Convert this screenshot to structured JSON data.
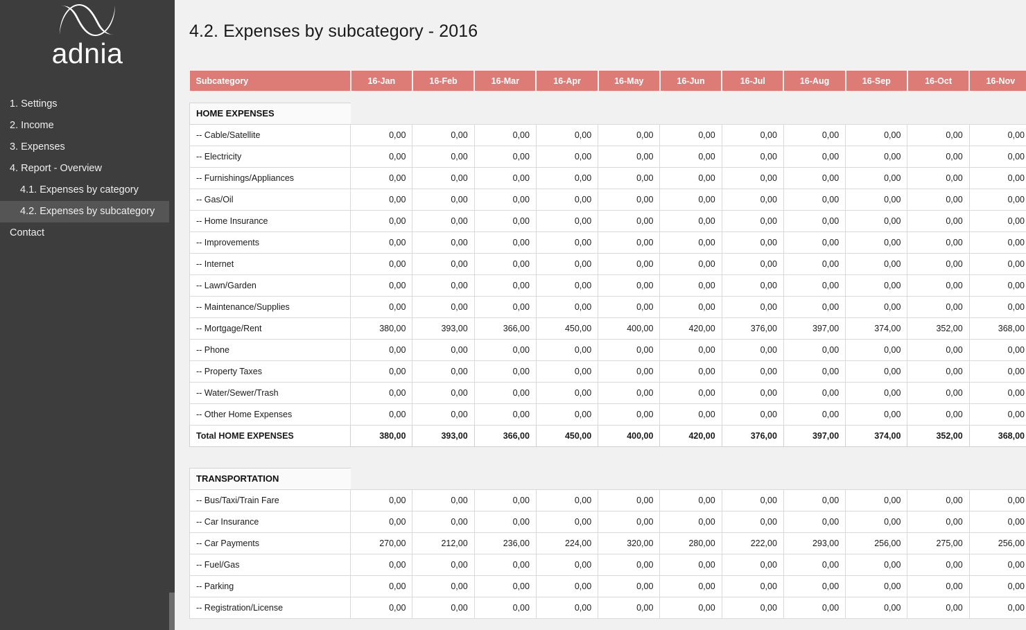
{
  "sidebar": {
    "logo": {
      "mark": "adnia-logo-mark",
      "word": "adnia"
    },
    "items": [
      {
        "label": "1. Settings",
        "level": 1,
        "active": false
      },
      {
        "label": "2. Income",
        "level": 1,
        "active": false
      },
      {
        "label": "3. Expenses",
        "level": 1,
        "active": false
      },
      {
        "label": "4. Report - Overview",
        "level": 1,
        "active": false
      },
      {
        "label": "4.1. Expenses by category",
        "level": 2,
        "active": false
      },
      {
        "label": "4.2. Expenses by subcategory",
        "level": 2,
        "active": true
      },
      {
        "label": "Contact",
        "level": 1,
        "active": false
      }
    ]
  },
  "main": {
    "title": "4.2. Expenses by subcategory - 2016",
    "accent_color": "#dd7c77",
    "table": {
      "columns": [
        "Subcategory",
        "16-Jan",
        "16-Feb",
        "16-Mar",
        "16-Apr",
        "16-May",
        "16-Jun",
        "16-Jul",
        "16-Aug",
        "16-Sep",
        "16-Oct",
        "16-Nov"
      ],
      "sections": [
        {
          "name": "HOME EXPENSES",
          "rows": [
            {
              "label": "-- Cable/Satellite",
              "values": [
                "0,00",
                "0,00",
                "0,00",
                "0,00",
                "0,00",
                "0,00",
                "0,00",
                "0,00",
                "0,00",
                "0,00",
                "0,00"
              ]
            },
            {
              "label": "-- Electricity",
              "values": [
                "0,00",
                "0,00",
                "0,00",
                "0,00",
                "0,00",
                "0,00",
                "0,00",
                "0,00",
                "0,00",
                "0,00",
                "0,00"
              ]
            },
            {
              "label": "-- Furnishings/Appliances",
              "values": [
                "0,00",
                "0,00",
                "0,00",
                "0,00",
                "0,00",
                "0,00",
                "0,00",
                "0,00",
                "0,00",
                "0,00",
                "0,00"
              ]
            },
            {
              "label": "-- Gas/Oil",
              "values": [
                "0,00",
                "0,00",
                "0,00",
                "0,00",
                "0,00",
                "0,00",
                "0,00",
                "0,00",
                "0,00",
                "0,00",
                "0,00"
              ]
            },
            {
              "label": "-- Home Insurance",
              "values": [
                "0,00",
                "0,00",
                "0,00",
                "0,00",
                "0,00",
                "0,00",
                "0,00",
                "0,00",
                "0,00",
                "0,00",
                "0,00"
              ]
            },
            {
              "label": "-- Improvements",
              "values": [
                "0,00",
                "0,00",
                "0,00",
                "0,00",
                "0,00",
                "0,00",
                "0,00",
                "0,00",
                "0,00",
                "0,00",
                "0,00"
              ]
            },
            {
              "label": "-- Internet",
              "values": [
                "0,00",
                "0,00",
                "0,00",
                "0,00",
                "0,00",
                "0,00",
                "0,00",
                "0,00",
                "0,00",
                "0,00",
                "0,00"
              ]
            },
            {
              "label": "-- Lawn/Garden",
              "values": [
                "0,00",
                "0,00",
                "0,00",
                "0,00",
                "0,00",
                "0,00",
                "0,00",
                "0,00",
                "0,00",
                "0,00",
                "0,00"
              ]
            },
            {
              "label": "-- Maintenance/Supplies",
              "values": [
                "0,00",
                "0,00",
                "0,00",
                "0,00",
                "0,00",
                "0,00",
                "0,00",
                "0,00",
                "0,00",
                "0,00",
                "0,00"
              ]
            },
            {
              "label": "-- Mortgage/Rent",
              "values": [
                "380,00",
                "393,00",
                "366,00",
                "450,00",
                "400,00",
                "420,00",
                "376,00",
                "397,00",
                "374,00",
                "352,00",
                "368,00"
              ]
            },
            {
              "label": "-- Phone",
              "values": [
                "0,00",
                "0,00",
                "0,00",
                "0,00",
                "0,00",
                "0,00",
                "0,00",
                "0,00",
                "0,00",
                "0,00",
                "0,00"
              ]
            },
            {
              "label": "-- Property Taxes",
              "values": [
                "0,00",
                "0,00",
                "0,00",
                "0,00",
                "0,00",
                "0,00",
                "0,00",
                "0,00",
                "0,00",
                "0,00",
                "0,00"
              ]
            },
            {
              "label": "-- Water/Sewer/Trash",
              "values": [
                "0,00",
                "0,00",
                "0,00",
                "0,00",
                "0,00",
                "0,00",
                "0,00",
                "0,00",
                "0,00",
                "0,00",
                "0,00"
              ]
            },
            {
              "label": "-- Other Home Expenses",
              "values": [
                "0,00",
                "0,00",
                "0,00",
                "0,00",
                "0,00",
                "0,00",
                "0,00",
                "0,00",
                "0,00",
                "0,00",
                "0,00"
              ]
            }
          ],
          "total": {
            "label": "Total HOME EXPENSES",
            "values": [
              "380,00",
              "393,00",
              "366,00",
              "450,00",
              "400,00",
              "420,00",
              "376,00",
              "397,00",
              "374,00",
              "352,00",
              "368,00"
            ]
          }
        },
        {
          "name": "TRANSPORTATION",
          "rows": [
            {
              "label": "-- Bus/Taxi/Train Fare",
              "values": [
                "0,00",
                "0,00",
                "0,00",
                "0,00",
                "0,00",
                "0,00",
                "0,00",
                "0,00",
                "0,00",
                "0,00",
                "0,00"
              ]
            },
            {
              "label": "-- Car Insurance",
              "values": [
                "0,00",
                "0,00",
                "0,00",
                "0,00",
                "0,00",
                "0,00",
                "0,00",
                "0,00",
                "0,00",
                "0,00",
                "0,00"
              ]
            },
            {
              "label": "-- Car Payments",
              "values": [
                "270,00",
                "212,00",
                "236,00",
                "224,00",
                "320,00",
                "280,00",
                "222,00",
                "293,00",
                "256,00",
                "275,00",
                "256,00"
              ]
            },
            {
              "label": "-- Fuel/Gas",
              "values": [
                "0,00",
                "0,00",
                "0,00",
                "0,00",
                "0,00",
                "0,00",
                "0,00",
                "0,00",
                "0,00",
                "0,00",
                "0,00"
              ]
            },
            {
              "label": "-- Parking",
              "values": [
                "0,00",
                "0,00",
                "0,00",
                "0,00",
                "0,00",
                "0,00",
                "0,00",
                "0,00",
                "0,00",
                "0,00",
                "0,00"
              ]
            },
            {
              "label": "-- Registration/License",
              "values": [
                "0,00",
                "0,00",
                "0,00",
                "0,00",
                "0,00",
                "0,00",
                "0,00",
                "0,00",
                "0,00",
                "0,00",
                "0,00"
              ]
            }
          ],
          "total": null
        }
      ]
    }
  }
}
